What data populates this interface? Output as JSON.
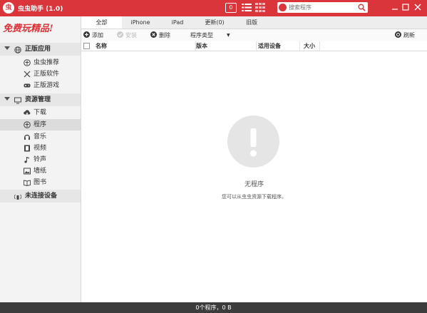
{
  "app": {
    "title": "虫虫助手 (1.0)",
    "logo_char": "虫",
    "mail_count": "0"
  },
  "search": {
    "placeholder": "搜索程序"
  },
  "banner": "免费玩精品!",
  "sidebar": {
    "groups": [
      {
        "label": "正版应用",
        "items": [
          "虫虫推荐",
          "正版软件",
          "正版游戏"
        ]
      },
      {
        "label": "资源管理",
        "items": [
          "下载",
          "程序",
          "音乐",
          "视频",
          "铃声",
          "墙纸",
          "图书"
        ]
      },
      {
        "label": "未连接设备",
        "items": []
      }
    ],
    "active_item": "程序"
  },
  "tabs": [
    "全部",
    "iPhone",
    "iPad",
    "更新(0)",
    "旧版"
  ],
  "active_tab": "全部",
  "toolbar": {
    "add": "添加",
    "install": "安装",
    "delete": "删除",
    "type": "程序类型",
    "refresh": "刷新"
  },
  "table": {
    "columns": [
      "名称",
      "版本",
      "适用设备",
      "大小"
    ]
  },
  "empty": {
    "title": "无程序",
    "subtitle": "您可以从虫虫资源下载程序。"
  },
  "status": "0个程序，0 B",
  "colors": {
    "brand": "#d9353b",
    "status_bar": "#3c3c3c",
    "sidebar": "#f3f3f3"
  }
}
